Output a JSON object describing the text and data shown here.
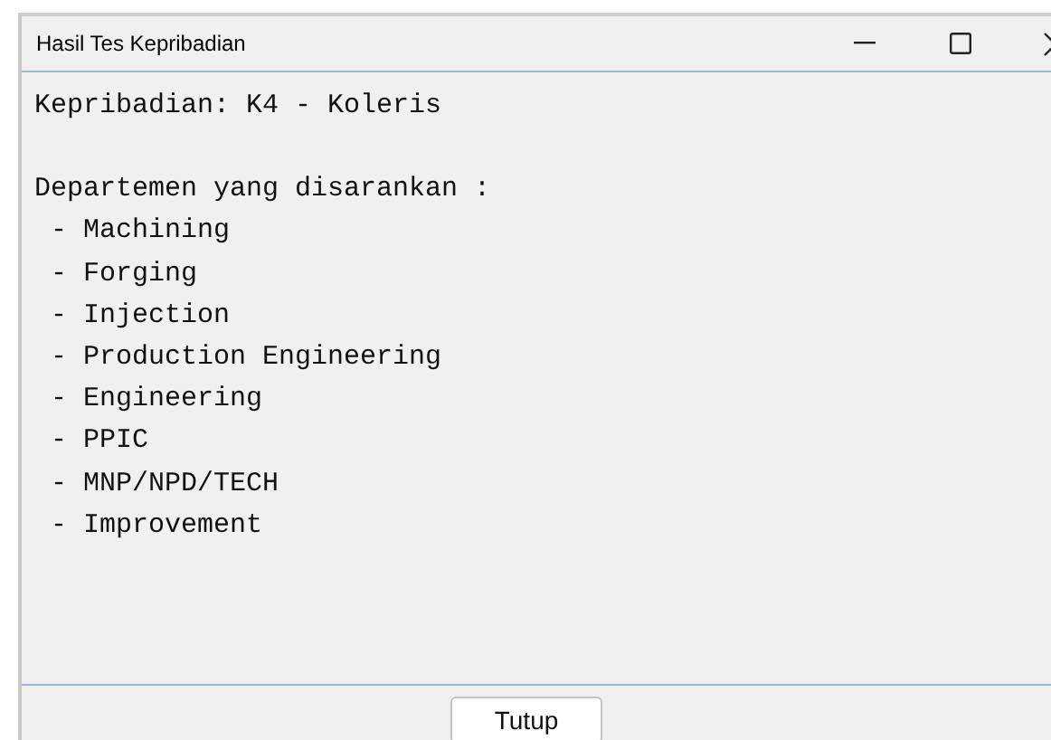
{
  "window": {
    "title": "Hasil Tes Kepribadian"
  },
  "content": {
    "heading": "Kepribadian: K4 - Koleris",
    "subheading": "Departemen yang disarankan :",
    "items": [
      "- Machining",
      "- Forging",
      "- Injection",
      "- Production Engineering",
      "- Engineering",
      "- PPIC",
      "- MNP/NPD/TECH",
      "- Improvement"
    ]
  },
  "buttons": [
    "Tutup"
  ]
}
